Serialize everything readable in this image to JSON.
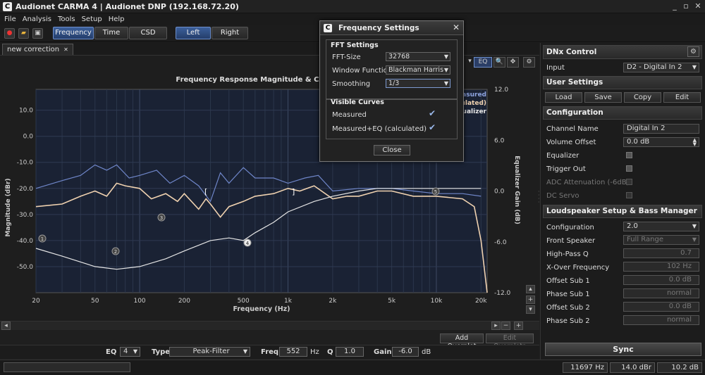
{
  "window": {
    "title": "Audionet CARMA 4 | Audionet DNP (192.168.72.20)",
    "logo": "C",
    "min": "_",
    "restore": "▫",
    "close": "✕"
  },
  "menu": [
    "File",
    "Analysis",
    "Tools",
    "Setup",
    "Help"
  ],
  "toolbar": {
    "views": [
      "Frequency",
      "Time",
      "CSD"
    ],
    "channels": [
      "Left",
      "Right"
    ]
  },
  "tab": {
    "label": "new correction",
    "close": "✕"
  },
  "plot": {
    "title": "Frequency Response Magnitude & CARMA EQ R",
    "toolbar": [
      "EQ"
    ],
    "legend": [
      "Measured",
      "(calculated)",
      "Equalizer"
    ],
    "markers": [
      "1",
      "2",
      "3",
      "4",
      "5"
    ]
  },
  "chart_data": {
    "type": "line",
    "xlabel": "Frequency (Hz)",
    "ylabel": "Magnitude (dBr)",
    "y2label": "Equalizer Gain (dB)",
    "xscale": "log",
    "xlim": [
      20,
      22000
    ],
    "ylim": [
      -60,
      18
    ],
    "y2lim": [
      -12,
      12
    ],
    "xticks": [
      "20",
      "50",
      "100",
      "200",
      "500",
      "1k",
      "2k",
      "5k",
      "10k",
      "20k"
    ],
    "xtick_values": [
      20,
      50,
      100,
      200,
      500,
      1000,
      2000,
      5000,
      10000,
      20000
    ],
    "yticks": [
      "10.0",
      "0.0",
      "-10.0",
      "-20.0",
      "-30.0",
      "-40.0",
      "-50.0"
    ],
    "ytick_values": [
      10,
      0,
      -10,
      -20,
      -30,
      -40,
      -50
    ],
    "y2ticks": [
      "12.0",
      "6.0",
      "0.0",
      "-6.0",
      "-12.0"
    ],
    "y2tick_values": [
      12,
      6,
      0,
      -6,
      -12
    ],
    "grid": true,
    "series": [
      {
        "name": "Measured",
        "color": "#6f86c9",
        "x": [
          20,
          30,
          40,
          50,
          60,
          70,
          85,
          100,
          130,
          160,
          200,
          250,
          300,
          350,
          400,
          500,
          600,
          800,
          1000,
          1300,
          1600,
          2000,
          3000,
          4000,
          5000,
          7000,
          10000,
          15000,
          20000
        ],
        "y": [
          -20,
          -17,
          -15,
          -11,
          -13,
          -11,
          -16,
          -15,
          -13,
          -18,
          -15,
          -19,
          -25,
          -14,
          -18,
          -12,
          -16,
          -16,
          -18,
          -16,
          -15,
          -21,
          -20,
          -20,
          -20,
          -21,
          -22,
          -22,
          -23
        ]
      },
      {
        "name": "Measured+EQ (calculated)",
        "color": "#f0d2b0",
        "x": [
          20,
          30,
          40,
          50,
          60,
          70,
          80,
          100,
          120,
          150,
          180,
          200,
          250,
          280,
          300,
          350,
          400,
          500,
          600,
          800,
          1000,
          1200,
          1500,
          2000,
          2500,
          3000,
          4000,
          5000,
          7000,
          10000,
          15000,
          18000,
          20000,
          22000
        ],
        "y": [
          -27,
          -26,
          -23,
          -21,
          -23,
          -18,
          -19,
          -20,
          -24,
          -22,
          -25,
          -22,
          -28,
          -24,
          -26,
          -31,
          -27,
          -25,
          -23,
          -22,
          -20,
          -21,
          -19,
          -24,
          -23,
          -23,
          -21,
          -21,
          -23,
          -23,
          -24,
          -27,
          -40,
          -60
        ]
      },
      {
        "name": "Equalizer",
        "color": "#e6e6e6",
        "x": [
          20,
          30,
          50,
          70,
          100,
          150,
          200,
          300,
          400,
          500,
          600,
          800,
          1000,
          1500,
          2000,
          3000,
          4000,
          5000,
          7000,
          10000,
          15000,
          20000
        ],
        "y": [
          -43,
          -46,
          -50,
          -51,
          -50,
          -47,
          -44,
          -40,
          -39,
          -40,
          -37,
          -33,
          -29,
          -25,
          -23,
          -21,
          -20,
          -20,
          -20,
          -20,
          -20,
          -20
        ]
      }
    ]
  },
  "overplot": {
    "add": "Add Overplot",
    "edit": "Edit Overplots"
  },
  "eqbar": {
    "eq_label": "EQ",
    "eq_value": "4",
    "type_label": "Type",
    "type_value": "Peak-Filter",
    "freq_label": "Freq.",
    "freq_value": "552",
    "freq_unit": "Hz",
    "q_label": "Q",
    "q_value": "1.0",
    "gain_label": "Gain",
    "gain_value": "-6.0",
    "gain_unit": "dB"
  },
  "status": {
    "freq": "11697 Hz",
    "mag": "14.0 dBr",
    "gain": "10.2 dB"
  },
  "dialog": {
    "title": "Frequency Settings",
    "fft_group": "FFT Settings",
    "fft_size_label": "FFT-Size",
    "fft_size_value": "32768",
    "window_label": "Window Function",
    "window_value": "Blackman Harris",
    "smoothing_label": "Smoothing",
    "smoothing_value": "1/3",
    "curves_group": "Visible Curves",
    "measured_label": "Measured",
    "measured_eq_label": "Measured+EQ (calculated)",
    "close": "Close"
  },
  "rightpanel": {
    "dnx_title": "DNx Control",
    "input_label": "Input",
    "input_value": "D2 - Digital In 2",
    "user_title": "User Settings",
    "user_buttons": [
      "Load",
      "Save",
      "Copy",
      "Edit"
    ],
    "config_title": "Configuration",
    "channel_name_label": "Channel Name",
    "channel_name_value": "Digital In 2",
    "volume_label": "Volume Offset",
    "volume_value": "0.0 dB",
    "equalizer_label": "Equalizer",
    "trigger_label": "Trigger Out",
    "adc_label": "ADC Attenuation (-6dB)",
    "dcservo_label": "DC Servo",
    "speaker_title": "Loudspeaker Setup & Bass Manager",
    "configuration_label": "Configuration",
    "configuration_value": "2.0",
    "front_label": "Front Speaker",
    "front_value": "Full Range",
    "hpq_label": "High-Pass Q",
    "hpq_value": "0.7",
    "xover_label": "X-Over Frequency",
    "xover_value": "102 Hz",
    "offset1_label": "Offset Sub 1",
    "offset1_value": "0.0 dB",
    "phase1_label": "Phase Sub 1",
    "phase1_value": "normal",
    "offset2_label": "Offset Sub 2",
    "offset2_value": "0.0 dB",
    "phase2_label": "Phase Sub 2",
    "phase2_value": "normal",
    "sync": "Sync"
  }
}
